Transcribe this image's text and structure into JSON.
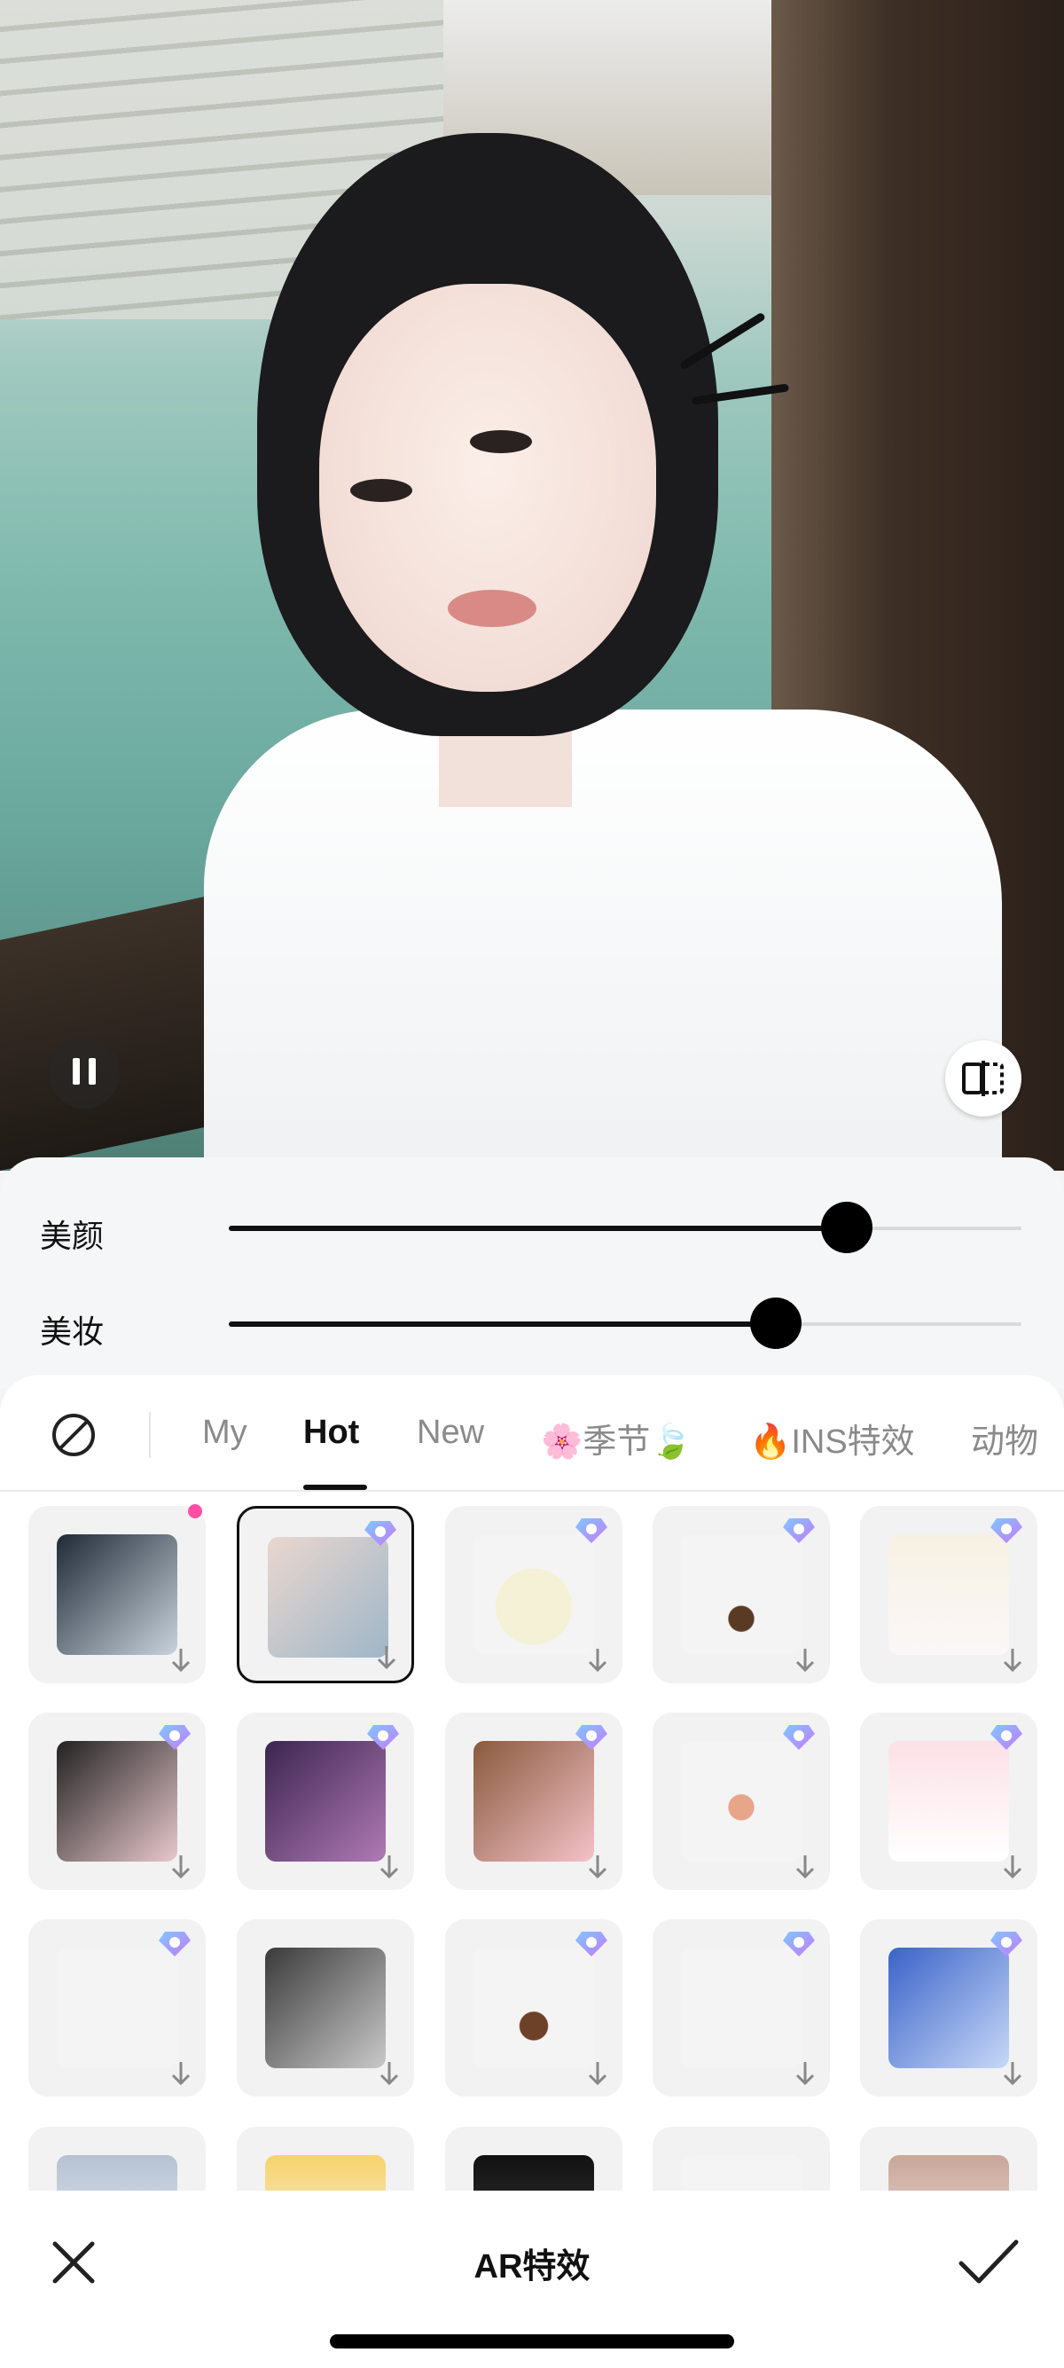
{
  "photo": {
    "description_icon_pause": "pause-icon",
    "description_icon_compare": "compare-icon"
  },
  "sliders": [
    {
      "label": "美颜",
      "value": 0.78
    },
    {
      "label": "美妆",
      "value": 0.69
    }
  ],
  "tabs": {
    "items": [
      "My",
      "Hot",
      "New",
      "🌸季节🍃",
      "🔥INS特效",
      "动物"
    ],
    "active": "Hot"
  },
  "effects_grid": {
    "rows": [
      [
        "effect-glasses-girl",
        "effect-selected-girl",
        "effect-face-mask",
        "effect-puppy-ears",
        "effect-cat-ears"
      ],
      [
        "effect-pink-makeup",
        "effect-split-face",
        "effect-flower-smile",
        "effect-groucho-glasses",
        "effect-bunny-ears"
      ],
      [
        "effect-blue-ribbons",
        "effect-sunglasses-headphones",
        "effect-dog-nose",
        "effect-pink-bows",
        "effect-bubbles"
      ],
      [
        "effect-girl-partial",
        "effect-sunflower",
        "effect-dark-portrait",
        "effect-cat-outline",
        "effect-portrait-partial"
      ]
    ]
  },
  "bottom_bar": {
    "title": "AR特效"
  },
  "colors": {
    "accent": "#111111",
    "new_dot": "#ff4fa3",
    "panel_bg": "#f4f6f7"
  }
}
